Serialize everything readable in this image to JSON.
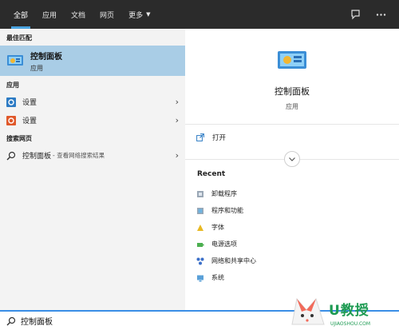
{
  "tabs": [
    {
      "label": "全部",
      "active": true
    },
    {
      "label": "应用"
    },
    {
      "label": "文档"
    },
    {
      "label": "网页"
    },
    {
      "label": "更多"
    }
  ],
  "left": {
    "best_match_header": "最佳匹配",
    "best_match": {
      "title": "控制面板",
      "subtitle": "应用"
    },
    "apps_header": "应用",
    "apps": [
      {
        "label": "设置",
        "icon": "gear-icon",
        "color": "#2d7bc4"
      },
      {
        "label": "设置",
        "icon": "settings-orange-icon",
        "color": "#e0582a"
      }
    ],
    "web_header": "搜索网页",
    "web_result": {
      "label": "控制面板",
      "sub": "- 查看网络搜索结果"
    }
  },
  "right": {
    "title": "控制面板",
    "subtitle": "应用",
    "open_label": "打开",
    "recent_header": "Recent",
    "recent": [
      {
        "label": "卸载程序",
        "icon": "uninstall-icon"
      },
      {
        "label": "程序和功能",
        "icon": "programs-icon"
      },
      {
        "label": "字体",
        "icon": "font-icon"
      },
      {
        "label": "电源选项",
        "icon": "power-icon"
      },
      {
        "label": "网络和共享中心",
        "icon": "network-icon"
      },
      {
        "label": "系统",
        "icon": "system-icon"
      }
    ]
  },
  "search": {
    "value": "控制面板"
  },
  "watermark": {
    "text": "U教授",
    "sub": "UJIAOSHOU.COM"
  },
  "colors": {
    "accent": "#4aa3df",
    "selected": "#a9cde6",
    "topbar": "#2b2b2b"
  }
}
